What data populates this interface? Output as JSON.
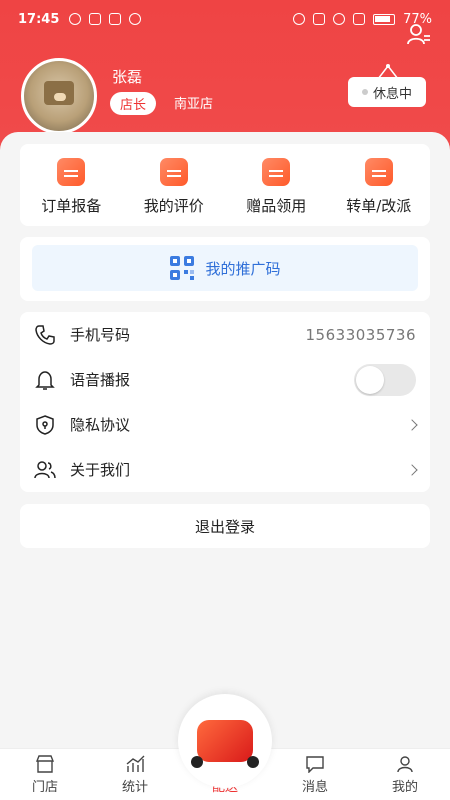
{
  "status_bar": {
    "time": "17:45",
    "battery": "77%"
  },
  "header": {
    "user_name": "张磊",
    "role": "店长",
    "store": "南亚店",
    "rest_status": "休息中"
  },
  "quick_actions": [
    {
      "label": "订单报备",
      "icon": "order-report-icon"
    },
    {
      "label": "我的评价",
      "icon": "review-flower-icon"
    },
    {
      "label": "赠品领用",
      "icon": "gift-icon"
    },
    {
      "label": "转单/改派",
      "icon": "transfer-order-icon"
    }
  ],
  "promo": {
    "label": "我的推广码"
  },
  "settings": {
    "phone_label": "手机号码",
    "phone_value": "15633035736",
    "voice_label": "语音播报",
    "privacy_label": "隐私协议",
    "about_label": "关于我们"
  },
  "logout": {
    "label": "退出登录"
  },
  "tabs": [
    {
      "label": "门店"
    },
    {
      "label": "统计"
    },
    {
      "label": "配送"
    },
    {
      "label": "消息"
    },
    {
      "label": "我的"
    }
  ],
  "colors": {
    "brand": "#ef4444",
    "promo_text": "#2f6fd8"
  }
}
